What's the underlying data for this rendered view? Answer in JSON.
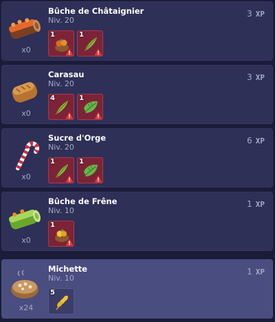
{
  "recipes": [
    {
      "name": "Bûche de Châtaignier",
      "level": "Niv. 20",
      "xp_value": "3",
      "xp_unit": "XP",
      "owned": "x0",
      "icon": "log-with-orange-icing-icon",
      "ingredients": [
        {
          "qty": "1",
          "icon": "chestnut-basket-icon",
          "missing": true
        },
        {
          "qty": "1",
          "icon": "green-feather-icon",
          "missing": true
        }
      ]
    },
    {
      "name": "Carasau",
      "level": "Niv. 20",
      "xp_value": "3",
      "xp_unit": "XP",
      "owned": "x0",
      "icon": "bread-loaf-icon",
      "ingredients": [
        {
          "qty": "4",
          "icon": "green-feather-icon",
          "missing": true
        },
        {
          "qty": "1",
          "icon": "green-leaf-icon",
          "missing": true
        }
      ]
    },
    {
      "name": "Sucre d'Orge",
      "level": "Niv. 20",
      "xp_value": "6",
      "xp_unit": "XP",
      "owned": "x0",
      "icon": "candy-cane-icon",
      "ingredients": [
        {
          "qty": "1",
          "icon": "green-feather-icon",
          "missing": true
        },
        {
          "qty": "1",
          "icon": "green-leaf-icon",
          "missing": true
        }
      ]
    },
    {
      "name": "Bûche de Frêne",
      "level": "Niv. 10",
      "xp_value": "1",
      "xp_unit": "XP",
      "owned": "x0",
      "icon": "green-log-icon",
      "ingredients": [
        {
          "qty": "1",
          "icon": "fruit-basket-icon",
          "missing": true
        }
      ]
    },
    {
      "name": "Michette",
      "level": "Niv. 10",
      "xp_value": "1",
      "xp_unit": "XP",
      "owned": "x24",
      "icon": "round-bread-icon",
      "selected": true,
      "ingredients": [
        {
          "qty": "5",
          "icon": "wheat-icon",
          "missing": false
        }
      ]
    }
  ]
}
